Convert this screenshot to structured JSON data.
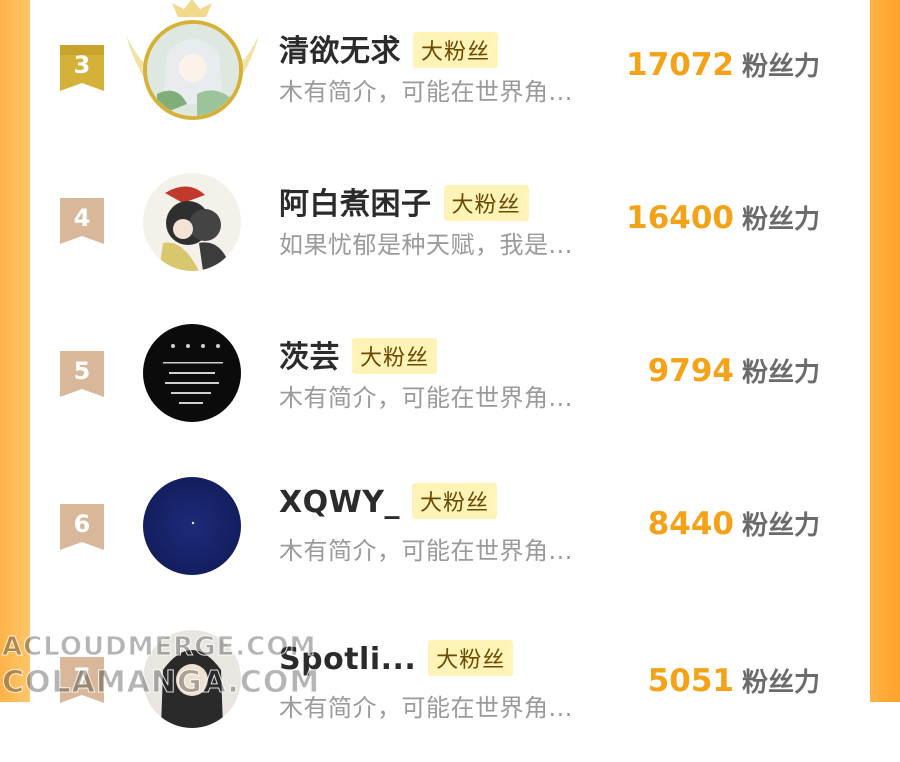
{
  "theme": {
    "accent": "#f4a318",
    "tag_bg": "#fff3b8",
    "side": "#ffb347"
  },
  "rows": [
    {
      "rank": "3",
      "name": "清欲无求",
      "tag": "大粉丝",
      "bio": "木有简介，可能在世界角...",
      "score": "17072",
      "unit": "粉丝力",
      "badge_color": "#d4b23a"
    },
    {
      "rank": "4",
      "name": "阿白煮困子",
      "tag": "大粉丝",
      "bio": "如果忧郁是种天赋，我是...",
      "score": "16400",
      "unit": "粉丝力",
      "badge_color": "#d8b79a"
    },
    {
      "rank": "5",
      "name": "茨芸",
      "tag": "大粉丝",
      "bio": "木有简介，可能在世界角...",
      "score": "9794",
      "unit": "粉丝力",
      "badge_color": "#d8b79a"
    },
    {
      "rank": "6",
      "name": "XQWY_",
      "tag": "大粉丝",
      "bio": "木有简介，可能在世界角...",
      "score": "8440",
      "unit": "粉丝力",
      "badge_color": "#d8b79a"
    },
    {
      "rank": "7",
      "name": "Spotli...",
      "tag": "大粉丝",
      "bio": "木有简介，可能在世界角...",
      "score": "5051",
      "unit": "粉丝力",
      "badge_color": "#d8b79a"
    }
  ],
  "watermark": {
    "line1": "ACLOUDMERGE.COM",
    "line2": "COLAMANGA.COM"
  }
}
